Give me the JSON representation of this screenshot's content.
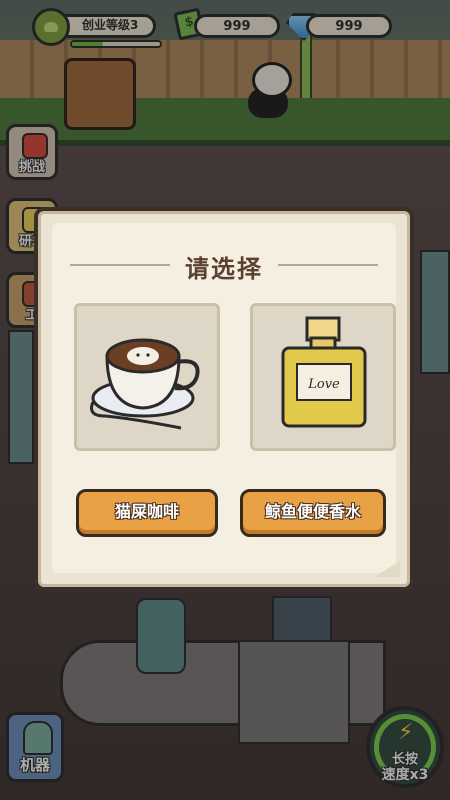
{
  "topbar": {
    "level_label": "创业等级3",
    "level_progress": 0.35,
    "cash_value": "999",
    "gem_value": "999"
  },
  "sidebar": {
    "items": [
      {
        "label": "挑战",
        "icon": "fist-icon"
      },
      {
        "label": "研发",
        "icon": "research-icon"
      },
      {
        "label": "工",
        "icon": "worker-icon"
      }
    ]
  },
  "dialog": {
    "title": "请选择",
    "options": [
      {
        "label": "猫屎咖啡",
        "icon": "latte-cup-icon"
      },
      {
        "label": "鲸鱼便便香水",
        "icon": "perfume-bottle-icon",
        "bottle_text": "Love"
      }
    ]
  },
  "bottom": {
    "machine_label": "机器",
    "speed_line1": "长按",
    "speed_line2": "速度x3"
  },
  "colors": {
    "button_orange": "#e9a146",
    "dialog_bg": "#f5efe2",
    "title_brown": "#5b3f2f"
  }
}
